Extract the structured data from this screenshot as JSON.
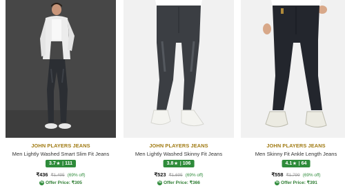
{
  "products": [
    {
      "brand": "JOHN PLAYERS JEANS",
      "title": "Men Lightly Washed Smart Slim Fit Jeans",
      "rating": "3.7",
      "reviews": "111",
      "price": "₹436",
      "mrp": "₹1,495",
      "discount": "(69% off)",
      "offer_label": "Offer Price: ₹305"
    },
    {
      "brand": "JOHN PLAYERS JEANS",
      "title": "Men Lightly Washed Skinny Fit Jeans",
      "rating": "3.8",
      "reviews": "106",
      "price": "₹523",
      "mrp": "₹1,695",
      "discount": "(69% off)",
      "offer_label": "Offer Price: ₹366"
    },
    {
      "brand": "JOHN PLAYERS JEANS",
      "title": "Men Skinny Fit Ankle Length Jeans",
      "rating": "4.1",
      "reviews": "64",
      "price": "₹558",
      "mrp": "₹1,799",
      "discount": "(69% off)",
      "offer_label": "Offer Price: ₹391"
    }
  ],
  "colors": {
    "brand_text": "#a07a12",
    "rating_badge": "#2e8b3a",
    "offer_text": "#2e7d32"
  },
  "icons": {
    "rating": "star-icon",
    "offer": "offer-tag-icon"
  }
}
